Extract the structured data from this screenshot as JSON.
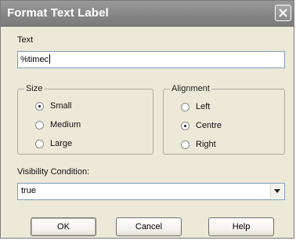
{
  "window": {
    "title": "Format Text Label"
  },
  "text_section": {
    "label": "Text",
    "value": "%timec"
  },
  "size_group": {
    "legend": "Size",
    "options": [
      {
        "label": "Small",
        "selected": true
      },
      {
        "label": "Medium",
        "selected": false
      },
      {
        "label": "Large",
        "selected": false
      }
    ]
  },
  "alignment_group": {
    "legend": "Alignment",
    "options": [
      {
        "label": "Left",
        "selected": false
      },
      {
        "label": "Centre",
        "selected": true
      },
      {
        "label": "Right",
        "selected": false
      }
    ]
  },
  "visibility": {
    "label": "Visibility Condition:",
    "value": "true"
  },
  "buttons": {
    "ok": "OK",
    "cancel": "Cancel",
    "help": "Help"
  },
  "icons": {
    "close": "close-icon",
    "dropdown": "chevron-down-icon"
  }
}
